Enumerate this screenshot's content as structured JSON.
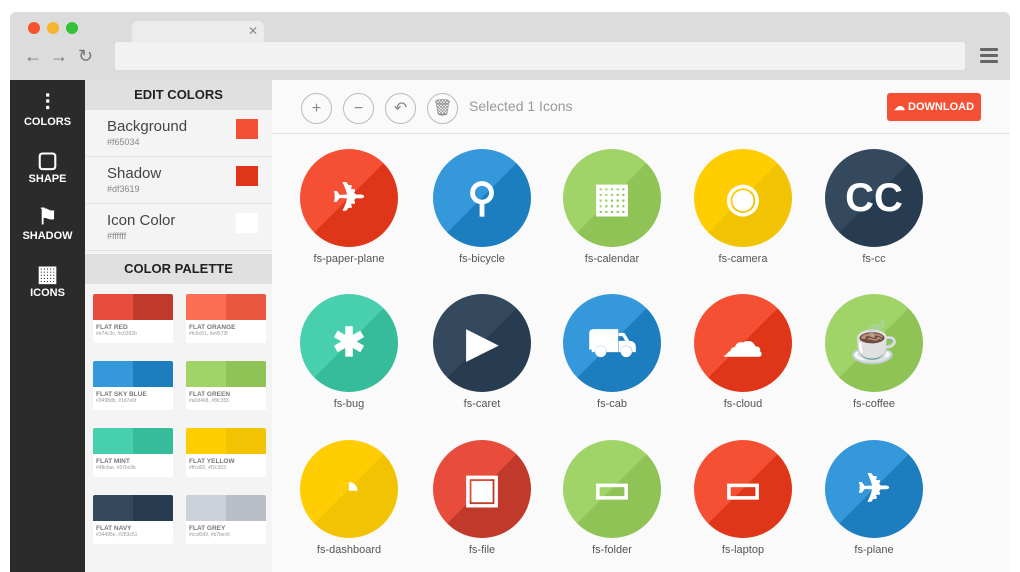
{
  "sidebar": {
    "items": [
      {
        "label": "COLORS",
        "icon": "sliders-icon",
        "glyph": "⫶"
      },
      {
        "label": "SHAPE",
        "icon": "square-icon",
        "glyph": "▢"
      },
      {
        "label": "SHADOW",
        "icon": "shadow-flag-icon",
        "glyph": "⚑"
      },
      {
        "label": "ICONS",
        "icon": "grid-icon",
        "glyph": "▦"
      }
    ]
  },
  "edit_colors": {
    "title": "EDIT COLORS",
    "rows": [
      {
        "name": "Background",
        "hex": "#f65034",
        "color": "#f65034"
      },
      {
        "name": "Shadow",
        "hex": "#df3619",
        "color": "#df3619"
      },
      {
        "name": "Icon Color",
        "hex": "#ffffff",
        "color": "#ffffff"
      }
    ]
  },
  "palette": {
    "title": "COLOR PALETTE",
    "items": [
      {
        "name": "FLAT RED",
        "hex": "#e74c3c, #c0392b",
        "c1": "#e74c3c",
        "c2": "#c0392b"
      },
      {
        "name": "FLAT ORANGE",
        "hex": "#fc6e51, #e9573f",
        "c1": "#fc6e51",
        "c2": "#e9573f"
      },
      {
        "name": "FLAT SKY BLUE",
        "hex": "#3498db, #1d7ebf",
        "c1": "#3498db",
        "c2": "#1d7ebf"
      },
      {
        "name": "FLAT GREEN",
        "hex": "#a0d468, #8fc355",
        "c1": "#a0d468",
        "c2": "#8fc355"
      },
      {
        "name": "FLAT MINT",
        "hex": "#48cfae, #37bc9b",
        "c1": "#48cfae",
        "c2": "#37bc9b"
      },
      {
        "name": "FLAT YELLOW",
        "hex": "#ffcd02, #f2c303",
        "c1": "#ffcd02",
        "c2": "#f2c303"
      },
      {
        "name": "FLAT NAVY",
        "hex": "#34495e, #283c51",
        "c1": "#34495e",
        "c2": "#283c51"
      },
      {
        "name": "FLAT GREY",
        "hex": "#ccd0d9, #b7bec6",
        "c1": "#ccd0d9",
        "c2": "#b7bec6"
      }
    ]
  },
  "toolbar": {
    "status": "Selected 1 Icons",
    "download": "DOWNLOAD",
    "buttons": [
      {
        "name": "zoom-in",
        "glyph": "+"
      },
      {
        "name": "zoom-out",
        "glyph": "−"
      },
      {
        "name": "undo",
        "glyph": "↶"
      },
      {
        "name": "delete",
        "glyph": "🗑"
      }
    ]
  },
  "icons": [
    {
      "label": "fs-paper-plane",
      "bg": "#f65034",
      "sh": "#df3619",
      "glyph": "✈"
    },
    {
      "label": "fs-bicycle",
      "bg": "#3498db",
      "sh": "#1d7ebf",
      "glyph": "⚲"
    },
    {
      "label": "fs-calendar",
      "bg": "#a0d468",
      "sh": "#8fc355",
      "glyph": "▦"
    },
    {
      "label": "fs-camera",
      "bg": "#ffcd02",
      "sh": "#f2c303",
      "glyph": "◉"
    },
    {
      "label": "fs-cc",
      "bg": "#34495e",
      "sh": "#283c51",
      "glyph": "CC"
    },
    {
      "label": "fs-bug",
      "bg": "#48cfae",
      "sh": "#37bc9b",
      "glyph": "✱"
    },
    {
      "label": "fs-caret",
      "bg": "#34495e",
      "sh": "#283c51",
      "glyph": "▶"
    },
    {
      "label": "fs-cab",
      "bg": "#3498db",
      "sh": "#1d7ebf",
      "glyph": "⛟"
    },
    {
      "label": "fs-cloud",
      "bg": "#f65034",
      "sh": "#df3619",
      "glyph": "☁"
    },
    {
      "label": "fs-coffee",
      "bg": "#a0d468",
      "sh": "#8fc355",
      "glyph": "☕"
    },
    {
      "label": "fs-dashboard",
      "bg": "#ffcd02",
      "sh": "#f2c303",
      "glyph": "◔"
    },
    {
      "label": "fs-file",
      "bg": "#e74c3c",
      "sh": "#c0392b",
      "glyph": "▣"
    },
    {
      "label": "fs-folder",
      "bg": "#a0d468",
      "sh": "#8fc355",
      "glyph": "▭"
    },
    {
      "label": "fs-laptop",
      "bg": "#f65034",
      "sh": "#df3619",
      "glyph": "▭"
    },
    {
      "label": "fs-plane",
      "bg": "#3498db",
      "sh": "#1d7ebf",
      "glyph": "✈"
    }
  ]
}
